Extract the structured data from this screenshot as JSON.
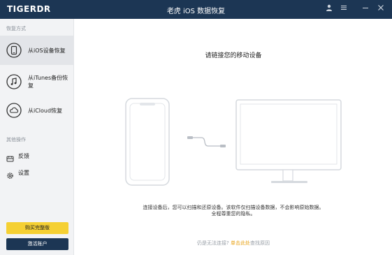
{
  "app": {
    "logo": "TIGERDR",
    "title": "老虎 iOS 数据恢复"
  },
  "window_controls": {
    "icons": [
      "user-icon",
      "menu-icon",
      "minimize-icon",
      "close-icon"
    ]
  },
  "sidebar": {
    "recover_section": "恢复方式",
    "items": [
      {
        "label": "从iOS设备恢复",
        "icon": "phone-icon",
        "active": true
      },
      {
        "label": "从iTunes备份恢复",
        "icon": "music-icon",
        "active": false
      },
      {
        "label": "从iCloud恢复",
        "icon": "cloud-icon",
        "active": false
      }
    ],
    "other_section": "其他操作",
    "other_items": [
      {
        "label": "反馈",
        "icon": "feedback-icon"
      },
      {
        "label": "设置",
        "icon": "gear-icon"
      }
    ],
    "buy_label": "购买完整版",
    "activate_label": "激活账户"
  },
  "main": {
    "heading": "请链接您的移动设备",
    "desc_line1": "连接设备后，您可以扫描和还原设备。该软件仅扫描设备数据，不会影响原始数据。",
    "desc_line2": "全程尊重您的隐私。",
    "footer_prefix": "仍是无法连接?",
    "footer_link": "单击此处",
    "footer_suffix": "查找原因"
  },
  "colors": {
    "titlebar": "#1c3654",
    "accent_yellow": "#f5d033",
    "link": "#e8a317"
  }
}
